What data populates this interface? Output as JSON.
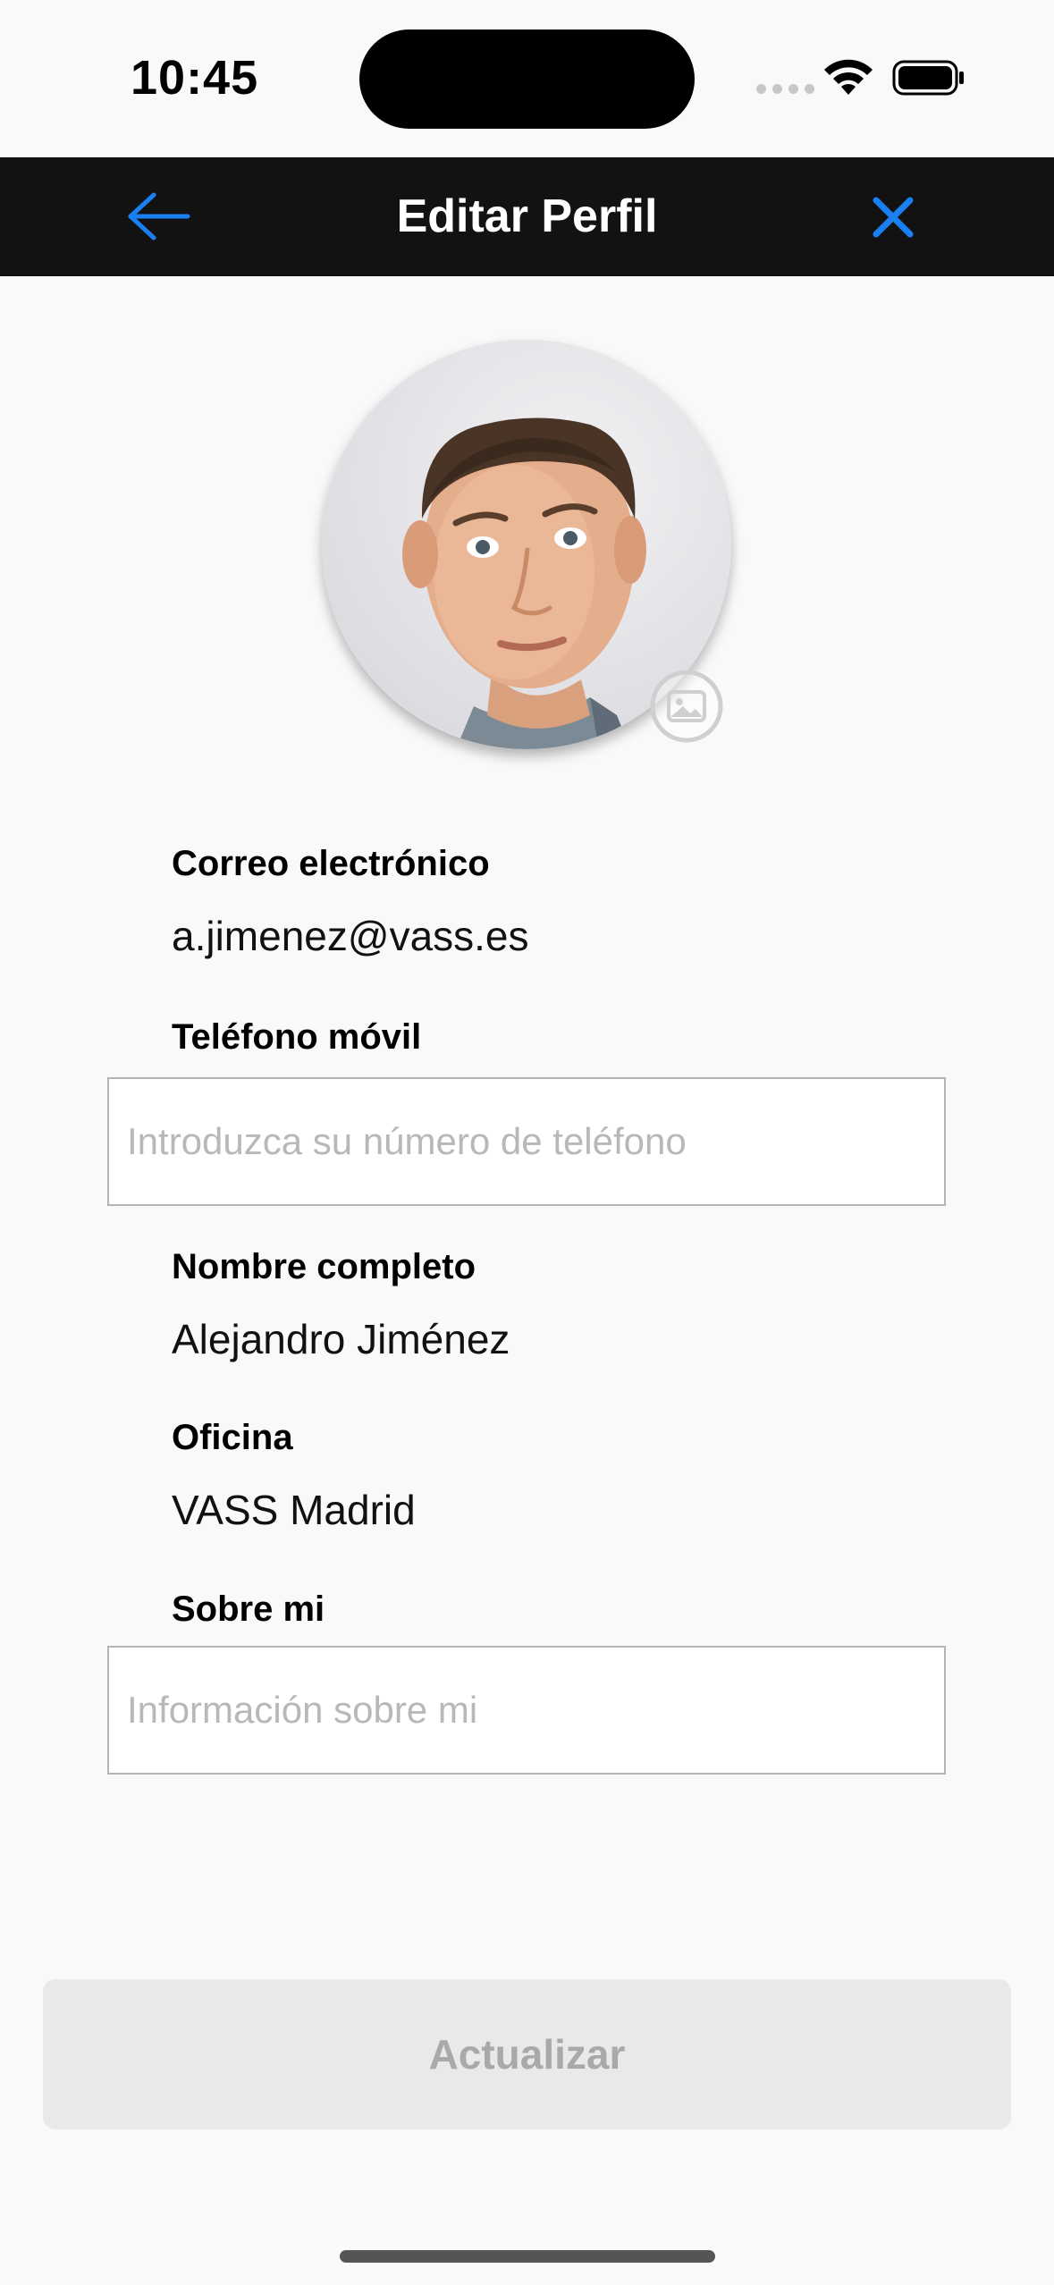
{
  "status_bar": {
    "time": "10:45",
    "icons": [
      "cellular-signal-icon",
      "wifi-icon",
      "battery-icon"
    ]
  },
  "nav": {
    "title": "Editar Perfil",
    "back_icon": "arrow-left-icon",
    "close_icon": "close-icon",
    "accent_color": "#1a7ff0"
  },
  "avatar": {
    "edit_icon": "image-icon"
  },
  "profile": {
    "email_label": "Correo electrónico",
    "email_value": "a.jimenez@vass.es",
    "phone_label": "Teléfono móvil",
    "phone_value": "",
    "phone_placeholder": "Introduzca su número de teléfono",
    "name_label": "Nombre completo",
    "name_value": "Alejandro Jiménez",
    "office_label": "Oficina",
    "office_value": "VASS Madrid",
    "about_label": "Sobre mi",
    "about_value": "",
    "about_placeholder": "Información sobre mi"
  },
  "actions": {
    "update_label": "Actualizar"
  }
}
